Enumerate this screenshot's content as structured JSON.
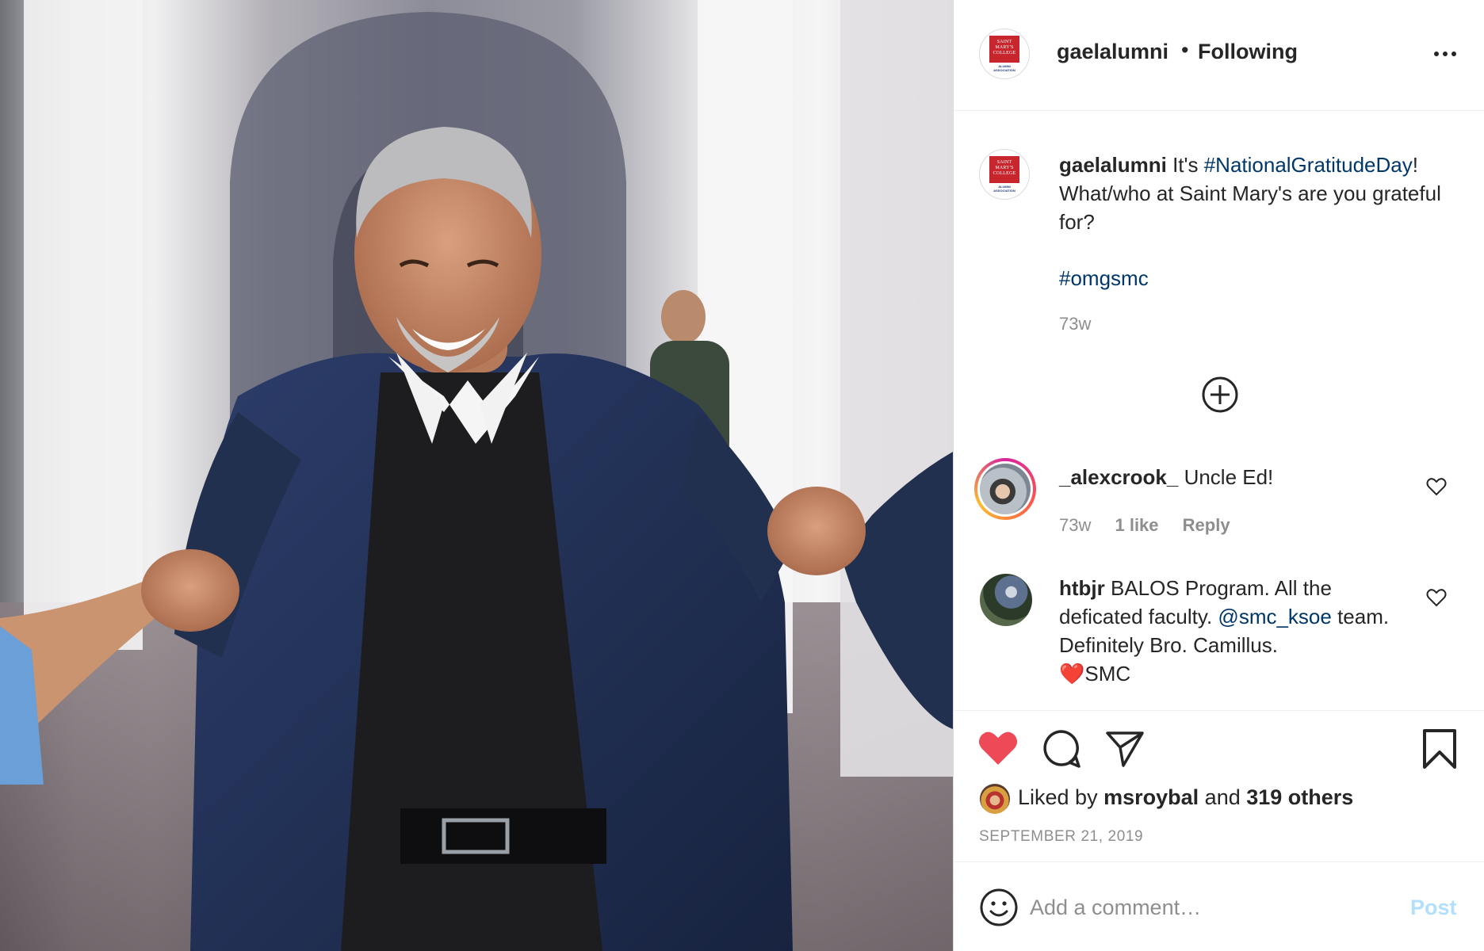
{
  "post": {
    "photo_alt": "",
    "header": {
      "username": "gaelalumni",
      "separator": "•",
      "follow_status": "Following",
      "avatar_logo": {
        "line1": "SAINT",
        "line2": "MARY'S",
        "line3": "COLLEGE",
        "sub1": "ALUMNI",
        "sub2": "ASSOCIATION"
      }
    },
    "caption": {
      "username": "gaelalumni",
      "text_before": "It's ",
      "hashtag1": "#NationalGratitudeDay",
      "text_after": "! What/who at Saint Mary's are you grateful for?",
      "hashtag2": "#omgsmc",
      "time": "73w"
    },
    "comments": [
      {
        "username": "_alexcrook_",
        "text": "Uncle Ed!",
        "time": "73w",
        "likes": "1 like",
        "reply": "Reply"
      },
      {
        "username": "htbjr",
        "text_before": "BALOS Program. All the deficated faculty. ",
        "mention": "@smc_ksoe",
        "text_after": " team. Definitely Bro. Camillus.",
        "emoji": "❤️",
        "text_end": "SMC"
      }
    ],
    "likes": {
      "prefix": "Liked by",
      "user": "msroybal",
      "connector": "and",
      "others": "319 others"
    },
    "date": "SEPTEMBER 21, 2019",
    "add_comment": {
      "placeholder": "Add a comment…",
      "post_label": "Post"
    },
    "colors": {
      "like_red": "#ed4956",
      "link_blue": "#00376b",
      "post_disabled": "#b2dffc",
      "muted": "#8e8e8e"
    },
    "icons": [
      "more-icon",
      "plus-circle-icon",
      "heart-icon",
      "comment-icon",
      "share-icon",
      "bookmark-icon",
      "emoji-icon"
    ]
  }
}
